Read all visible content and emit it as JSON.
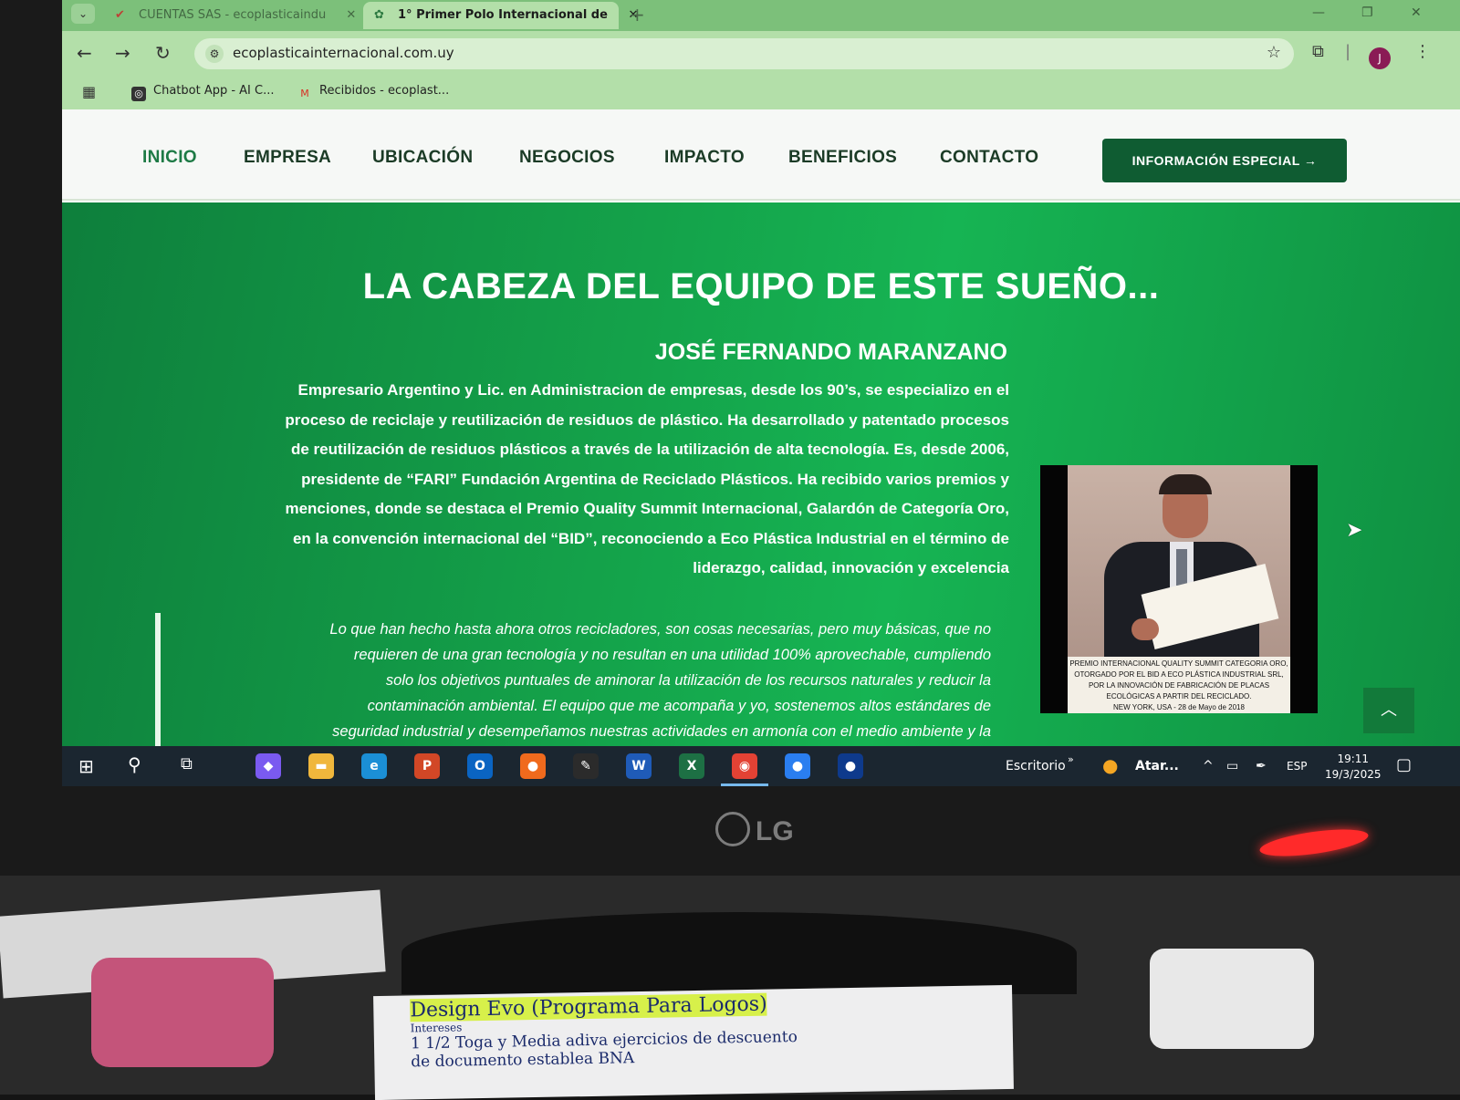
{
  "browser": {
    "tabs": [
      {
        "label": "CUENTAS SAS - ecoplasticaindu",
        "icon": "check-mark-icon"
      },
      {
        "label": "1° Primer Polo Internacional de",
        "icon": "leaf-globe-icon"
      }
    ],
    "url": "ecoplasticainternacional.com.uy",
    "profile_initial": "J",
    "bookmarks": [
      {
        "label": "Chatbot App - AI C...",
        "icon": "chatbot-icon"
      },
      {
        "label": "Recibidos - ecoplast...",
        "icon": "gmail-icon"
      }
    ]
  },
  "site": {
    "nav": [
      "INICIO",
      "EMPRESA",
      "UBICACIÓN",
      "NEGOCIOS",
      "IMPACTO",
      "BENEFICIOS",
      "CONTACTO"
    ],
    "active_nav": "INICIO",
    "cta_label": "INFORMACIÓN ESPECIAL →",
    "hero": {
      "title": "LA CABEZA DEL EQUIPO DE ESTE SUEÑO...",
      "name": "JOSÉ FERNANDO MARANZANO",
      "bio_lines": [
        "Empresario Argentino y Lic. en Administracion de empresas, desde los 90’s, se especializo en el",
        "proceso de reciclaje y reutilización de residuos de plástico. Ha desarrollado y patentado procesos",
        "de reutilización de residuos plásticos a través de la utilización de alta tecnología. Es, desde 2006,",
        "presidente de “FARI” Fundación Argentina de Reciclado Plásticos. Ha recibido varios premios y",
        "menciones, donde se destaca el Premio Quality Summit Internacional,  Galardón de Categoría Oro,",
        "en la convención internacional del “BID”, reconociendo a Eco Plástica Industrial en el término de",
        "liderazgo, calidad, innovación y excelencia"
      ],
      "quote_lines": [
        "Lo que han hecho hasta ahora otros recicladores, son cosas necesarias, pero muy básicas, que no",
        "requieren de una gran tecnología y no resultan en una utilidad 100% aprovechable, cumpliendo",
        "solo los objetivos puntuales de aminorar la utilización de los recursos naturales y reducir la",
        "contaminación ambiental. El equipo que me acompaña y yo, sostenemos altos estándares de",
        "seguridad industrial y desempeñamos nuestras actividades en armonía con el medio ambiente y la"
      ],
      "photo_caption": [
        "PREMIO INTERNACIONAL QUALITY SUMMIT CATEGORIA ORO,",
        "OTORGADO POR EL BID  A ECO PLÁSTICA INDUSTRIAL SRL,",
        "POR LA INNOVACIÓN DE FABRICACIÓN DE PLACAS",
        "ECOLÓGICAS A PARTIR DEL RECICLADO.",
        "NEW YORK, USA - 28 de Mayo de 2018"
      ]
    }
  },
  "taskbar": {
    "apps": [
      {
        "name": "copilot",
        "glyph": "◆",
        "color": "#7a5af0"
      },
      {
        "name": "file-explorer",
        "glyph": "▬",
        "color": "#f0b73c"
      },
      {
        "name": "edge",
        "glyph": "e",
        "color": "#1b8fd6"
      },
      {
        "name": "powerpoint",
        "glyph": "P",
        "color": "#d24726"
      },
      {
        "name": "outlook",
        "glyph": "O",
        "color": "#0a64c2"
      },
      {
        "name": "firefox",
        "glyph": "●",
        "color": "#f06a1d"
      },
      {
        "name": "whatsapp-web",
        "glyph": "✎",
        "color": "#2b2b2b"
      },
      {
        "name": "word",
        "glyph": "W",
        "color": "#1f5bb8"
      },
      {
        "name": "excel",
        "glyph": "X",
        "color": "#1d7044"
      },
      {
        "name": "chrome",
        "glyph": "◉",
        "color": "#e34234"
      },
      {
        "name": "app-blue",
        "glyph": "●",
        "color": "#2a7ef0"
      },
      {
        "name": "app-dark",
        "glyph": "●",
        "color": "#0e3a8c"
      }
    ],
    "desktop_label": "Escritorio",
    "weather": "Atar...",
    "language": "ESP",
    "time": "19:11",
    "date": "19/3/2025"
  },
  "monitor": {
    "brand": "LG"
  },
  "desk_note": {
    "line1": "Design Evo (Programa Para Logos)",
    "line2": "Intereses",
    "line3": "1 1/2 Toga y Media adiva ejercicios de descuento",
    "line4": "de documento establea BNA"
  }
}
